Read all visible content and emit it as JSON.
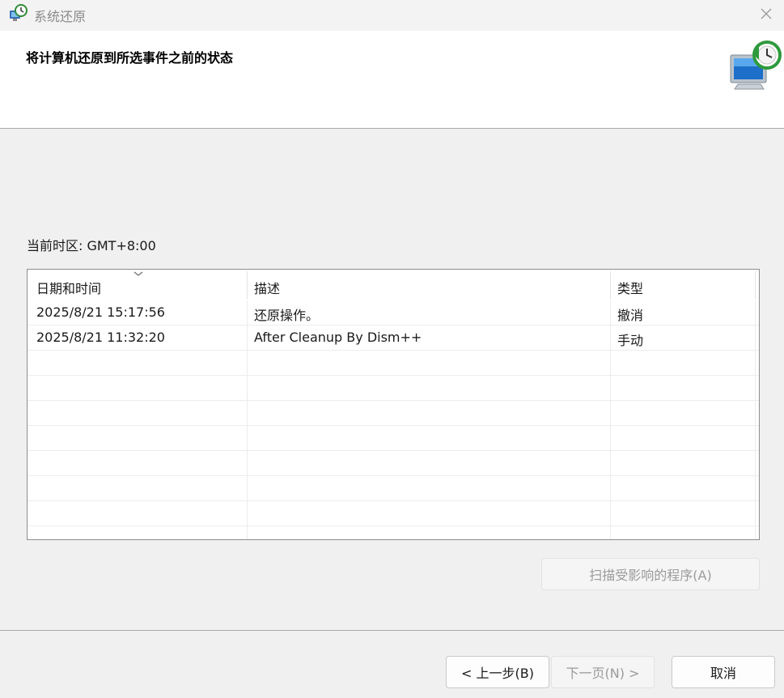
{
  "window": {
    "title": "系统还原"
  },
  "header": {
    "title": "将计算机还原到所选事件之前的状态"
  },
  "timezone_label": "当前时区: GMT+8:00",
  "table": {
    "columns": [
      "日期和时间",
      "描述",
      "类型"
    ],
    "rows": [
      {
        "datetime": "2025/8/21 15:17:56",
        "description": "还原操作。",
        "type": "撤消"
      },
      {
        "datetime": "2025/8/21 11:32:20",
        "description": "After Cleanup By Dism++",
        "type": "手动"
      }
    ]
  },
  "buttons": {
    "scan": "扫描受影响的程序(A)",
    "back": "< 上一步(B)",
    "next": "下一页(N) >",
    "cancel": "取消"
  },
  "icons": {
    "app": "system-restore-icon",
    "close": "close-icon",
    "header": "computer-restore-icon",
    "sort": "sort-descending-icon"
  }
}
